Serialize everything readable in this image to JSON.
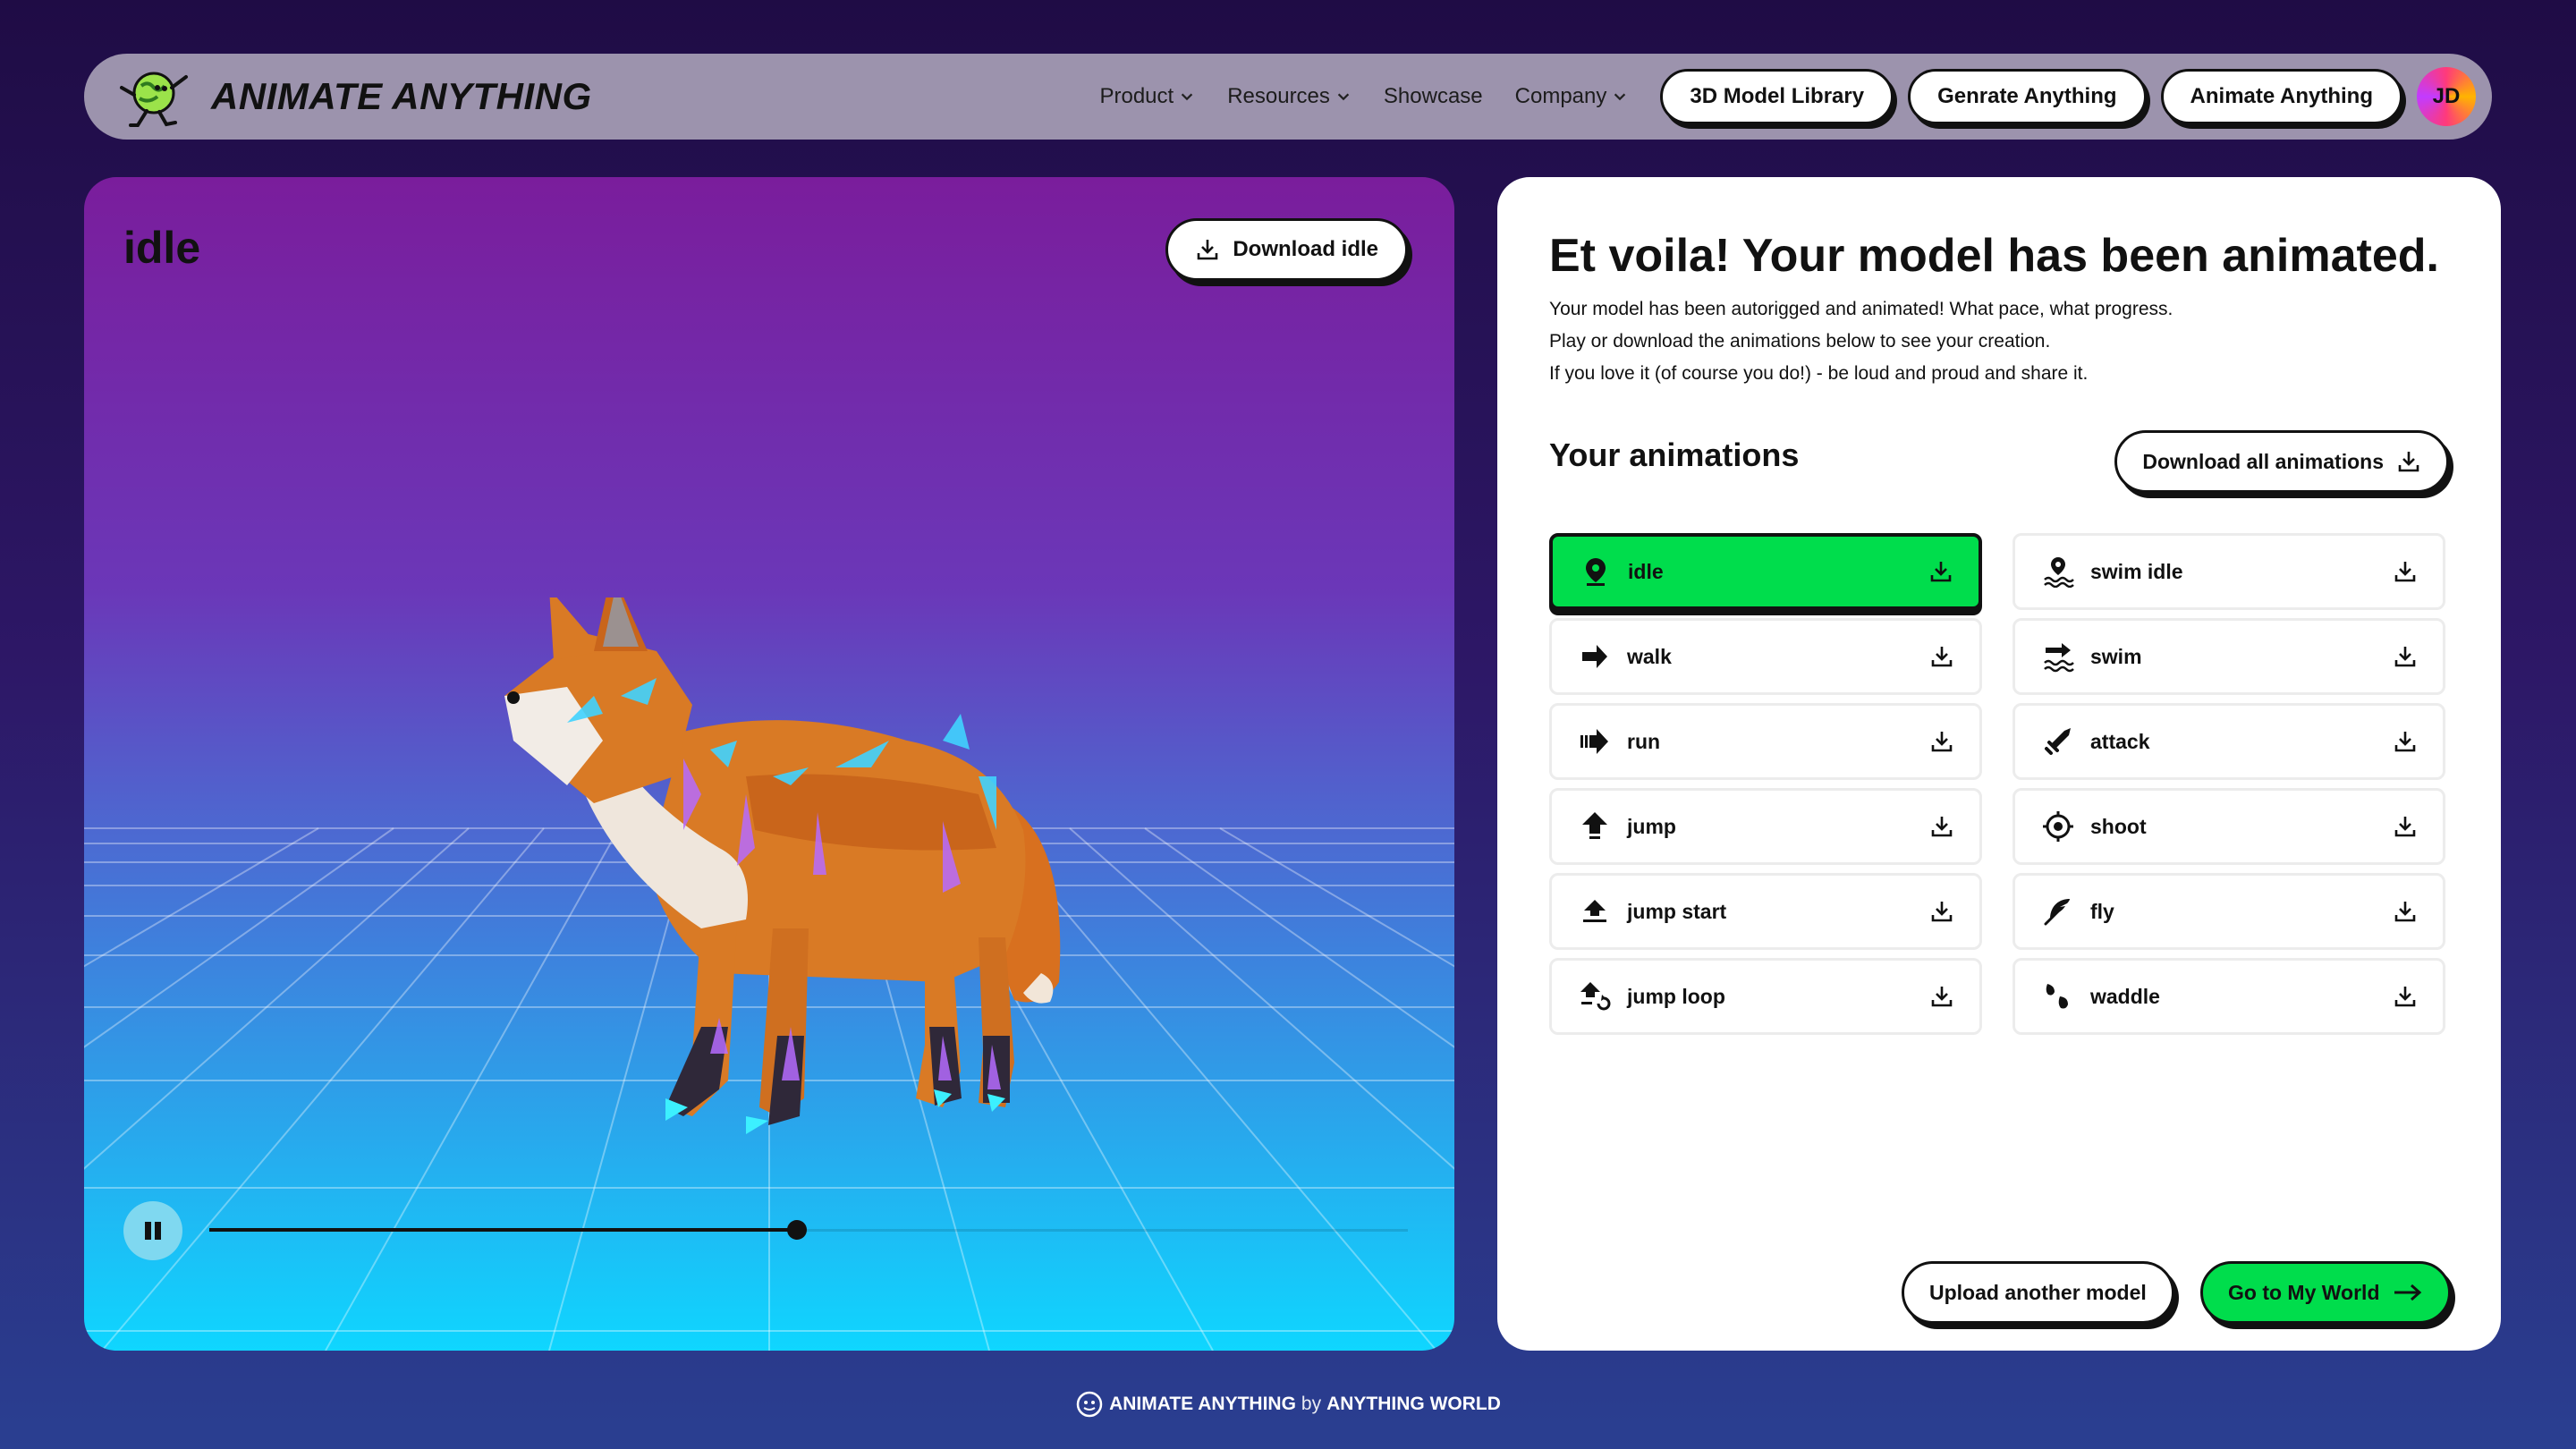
{
  "brand": {
    "name": "ANIMATE ANYTHING",
    "logo_icon": "running-globe-icon"
  },
  "nav": {
    "links": [
      {
        "label": "Product",
        "has_dropdown": true
      },
      {
        "label": "Resources",
        "has_dropdown": true
      },
      {
        "label": "Showcase",
        "has_dropdown": false
      },
      {
        "label": "Company",
        "has_dropdown": true
      }
    ],
    "buttons": [
      "3D Model Library",
      "Genrate Anything",
      "Animate Anything"
    ],
    "avatar_initials": "JD"
  },
  "viewer": {
    "title": "idle",
    "download_label": "Download idle",
    "playback": {
      "state": "playing",
      "progress": 0.49
    }
  },
  "panel": {
    "heading": "Et voila! Your model has been animated.",
    "description": [
      "Your model has been autorigged and animated! What pace, what progress.",
      "Play or download the animations below to see your creation.",
      "If you love it (of course you do!) - be loud and proud and share it."
    ],
    "animations_heading": "Your animations",
    "download_all_label": "Download all animations",
    "animations": [
      {
        "label": "idle",
        "icon": "map-pin-icon",
        "active": true
      },
      {
        "label": "swim idle",
        "icon": "swimmer-icon",
        "active": false
      },
      {
        "label": "walk",
        "icon": "arrow-right-icon",
        "active": false
      },
      {
        "label": "swim",
        "icon": "waves-icon",
        "active": false
      },
      {
        "label": "run",
        "icon": "fast-arrow-icon",
        "active": false
      },
      {
        "label": "attack",
        "icon": "sword-icon",
        "active": false
      },
      {
        "label": "jump",
        "icon": "arrow-up-icon",
        "active": false
      },
      {
        "label": "shoot",
        "icon": "crosshair-icon",
        "active": false
      },
      {
        "label": "jump start",
        "icon": "arrow-up-bar-icon",
        "active": false
      },
      {
        "label": "fly",
        "icon": "feather-icon",
        "active": false
      },
      {
        "label": "jump loop",
        "icon": "arrow-up-loop-icon",
        "active": false
      },
      {
        "label": "waddle",
        "icon": "footprints-icon",
        "active": false
      }
    ],
    "upload_label": "Upload another model",
    "world_label": "Go to My World"
  },
  "footer": {
    "brand": "ANIMATE ANYTHING",
    "by": "by",
    "company": "ANYTHING WORLD"
  },
  "colors": {
    "accent_green": "#00dd4c",
    "dark": "#111111",
    "nav_bg": "#9c93ad"
  }
}
